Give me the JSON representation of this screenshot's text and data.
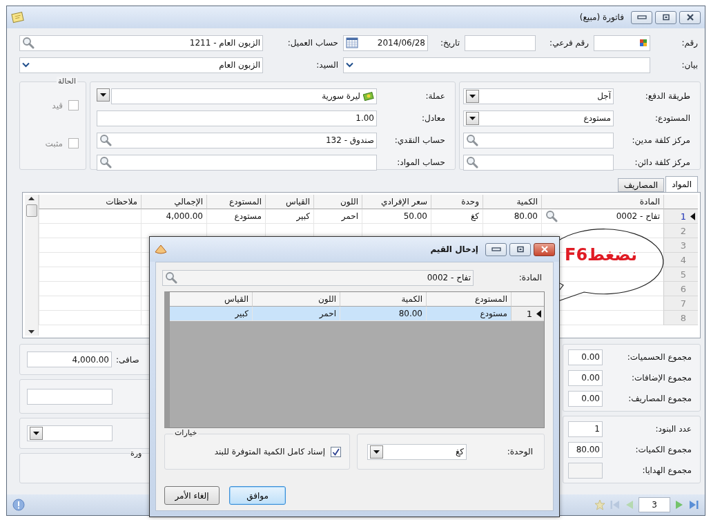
{
  "window": {
    "title": "فاتورة (مبيع)"
  },
  "header": {
    "number": {
      "label": "رقم:"
    },
    "sub_number": {
      "label": "رقم فرعي:"
    },
    "date": {
      "label": "تاريخ:",
      "value": "2014/06/28"
    },
    "customer_account": {
      "label": "حساب العميل:",
      "value": "1211 - الزبون العام"
    },
    "statement": {
      "label": "بيان:"
    },
    "mister": {
      "label": "السيد:",
      "value": "الزبون العام"
    }
  },
  "payment_group": {
    "fields": [
      {
        "label": "طريقة الدفع:",
        "value": "آجل",
        "kind": "combo"
      },
      {
        "label": "المستودع:",
        "value": "مستودع",
        "kind": "combo"
      },
      {
        "label": "مركز كلفة مدين:",
        "kind": "lookup"
      },
      {
        "label": "مركز كلفة دائن:",
        "kind": "lookup"
      }
    ]
  },
  "currency_group": {
    "fields": [
      {
        "label": "عملة:",
        "value": "ليرة سورية",
        "kind": "currency"
      },
      {
        "label": "معادل:",
        "value": "1.00",
        "kind": "text"
      },
      {
        "label": "حساب النقدي:",
        "value": "132 - صندوق",
        "kind": "lookup"
      },
      {
        "label": "حساب المواد:",
        "kind": "lookup"
      }
    ]
  },
  "status_group": {
    "title": "الحالة",
    "checks": [
      {
        "label": "قيد",
        "checked": false,
        "disabled": true
      },
      {
        "label": "مثبت",
        "checked": false,
        "disabled": true
      }
    ]
  },
  "tabs": [
    {
      "label": "المواد",
      "selected": true
    },
    {
      "label": "المصاريف",
      "selected": false
    }
  ],
  "table": {
    "columns": [
      "المادة",
      "الكمية",
      "وحدة",
      "سعر الإفرادي",
      "اللون",
      "القياس",
      "المستودع",
      "الإجمالي",
      "ملاحظات"
    ],
    "rows": [
      {
        "number": "1",
        "selected": true,
        "cells": [
          "0002 - تفاح",
          "80.00",
          "كغ",
          "50.00",
          "احمر",
          "كبير",
          "مستودع",
          "4,000.00"
        ]
      },
      {
        "number": "2",
        "selected": false
      },
      {
        "number": "3",
        "selected": false
      },
      {
        "number": "4",
        "selected": false
      },
      {
        "number": "5",
        "selected": false
      },
      {
        "number": "6",
        "selected": false
      },
      {
        "number": "7",
        "selected": false
      },
      {
        "number": "8",
        "selected": false
      }
    ]
  },
  "summary_left": {
    "net": {
      "label": "صافى:",
      "value": "4,000.00"
    },
    "legend": "ورة"
  },
  "totals": [
    {
      "label": "مجموع الحسميات:",
      "value": "0.00"
    },
    {
      "label": "مجموع الإضافات:",
      "value": "0.00"
    },
    {
      "label": "مجموع المصاريف:",
      "value": "0.00"
    }
  ],
  "counts": [
    {
      "label": "عدد البنود:",
      "value": "1"
    },
    {
      "label": "مجموع الكميات:",
      "value": "80.00"
    },
    {
      "label": "مجموع الهدايا:"
    }
  ],
  "status_bar": {
    "page": "3"
  },
  "dialog": {
    "title": "إدخال القيم",
    "material": {
      "label": "المادة:",
      "value": "0002 - تفاح"
    },
    "table": {
      "columns": [
        "المستودع",
        "الكمية",
        "اللون",
        "القياس"
      ],
      "rows": [
        {
          "number": "1",
          "selected": true,
          "cells": [
            "مستودع",
            "80.00",
            "احمر",
            "كبير"
          ]
        }
      ]
    },
    "unit": {
      "label": "الوحدة:",
      "value": "كغ"
    },
    "options": {
      "title": "خيارات",
      "checks": [
        {
          "label": "إسناد كامل الكمية المتوفرة للبند",
          "checked": true
        }
      ]
    },
    "buttons": [
      {
        "label": "موافق",
        "kind": "default"
      },
      {
        "label": "إلغاء الأمر",
        "kind": "normal"
      }
    ]
  },
  "callout": {
    "text": "نضغطF6"
  }
}
